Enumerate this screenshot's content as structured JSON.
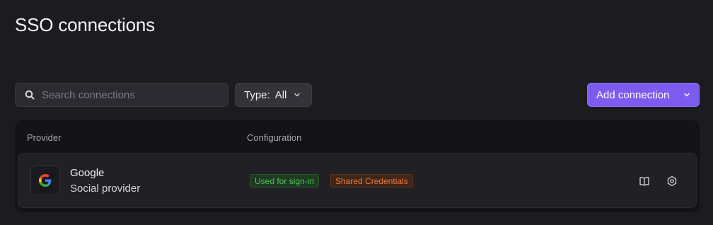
{
  "page": {
    "title": "SSO connections"
  },
  "toolbar": {
    "search_placeholder": "Search connections",
    "type_label": "Type:",
    "type_value": "All",
    "add_label": "Add connection"
  },
  "table": {
    "headers": {
      "provider": "Provider",
      "configuration": "Configuration"
    },
    "rows": [
      {
        "name": "Google",
        "type": "Social provider",
        "badges": [
          "Used for sign-in",
          "Shared Credentials"
        ]
      }
    ]
  },
  "icons": {
    "search": "search-icon",
    "type_chevron": "chevron-down-icon",
    "add_chevron": "chevron-down-icon",
    "provider_logo": "google-icon",
    "docs": "book-icon",
    "settings": "gear-icon"
  },
  "colors": {
    "accent": "#7c5cf0",
    "badge_green": "#4ec25a",
    "badge_orange": "#ec7a44",
    "background": "#1c1b1f"
  }
}
